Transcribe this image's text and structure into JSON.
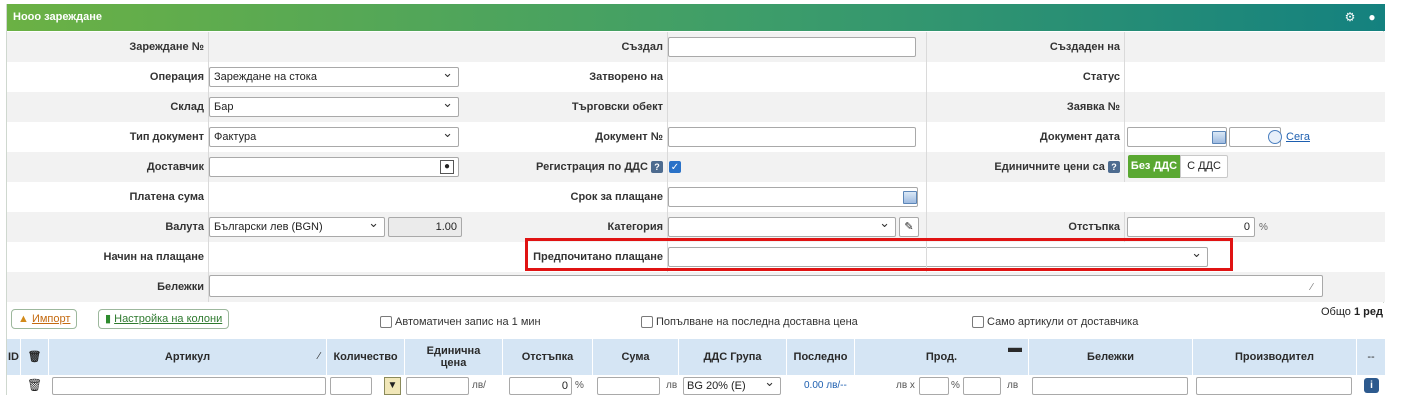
{
  "window": {
    "title": "Нооо зареждане"
  },
  "header_icons": [
    "gear-icon",
    "collapse-icon"
  ],
  "form": {
    "zarezhdane_no": {
      "label": "Зареждане №",
      "value": ""
    },
    "operation": {
      "label": "Операция",
      "value": "Зареждане на стока"
    },
    "sklad": {
      "label": "Склад",
      "value": "Бар"
    },
    "doc_type": {
      "label": "Тип документ",
      "value": "Фактура"
    },
    "dostavchik": {
      "label": "Доставчик",
      "value": ""
    },
    "platena_suma": {
      "label": "Платена сума",
      "value": ""
    },
    "valuta": {
      "label": "Валута",
      "value": "Български лев (BGN)",
      "rate": "1.00"
    },
    "nachin_plashtane": {
      "label": "Начин на плащане",
      "value": ""
    },
    "sazdal": {
      "label": "Създал",
      "value": ""
    },
    "zatvoreno_na": {
      "label": "Затворено на",
      "value": ""
    },
    "targovski_obekt": {
      "label": "Търговски обект",
      "value": ""
    },
    "dokument_no": {
      "label": "Документ №",
      "value": ""
    },
    "registracia_dds": {
      "label": "Регистрация по ДДС",
      "checked": true
    },
    "srok_plashtane": {
      "label": "Срок за плащане",
      "value": ""
    },
    "kategoria": {
      "label": "Категория",
      "value": ""
    },
    "predpochitano": {
      "label": "Предпочитано плащане",
      "value": ""
    },
    "sazdaden_na": {
      "label": "Създаден на",
      "value": ""
    },
    "status": {
      "label": "Статус",
      "value": ""
    },
    "zayavka_no": {
      "label": "Заявка №",
      "value": ""
    },
    "dokument_data": {
      "label": "Документ дата",
      "now_link": "Сега"
    },
    "edinichni_ceni": {
      "label": "Единичните цени са",
      "options": [
        "Без ДДС",
        "С ДДС"
      ],
      "selected": "Без ДДС"
    },
    "otstapka": {
      "label": "Отстъпка",
      "value": "0",
      "unit": "%"
    },
    "belejki": {
      "label": "Бележки",
      "value": ""
    }
  },
  "toolbar": {
    "import_label": "Импорт",
    "columns_label": "Настройка на колони",
    "auto_save_label": "Автоматичен запис на 1 мин",
    "last_price_label": "Попълване на последна доставна цена",
    "supplier_only_label": "Само артикули от доставчика",
    "total_label": "Общо",
    "total_count": "1 ред"
  },
  "table": {
    "columns": [
      "ID",
      "Артикул",
      "Количество",
      "Единична цена",
      "Отстъпка",
      "Сума",
      "ДДС Група",
      "Последно",
      "Прод.",
      "Бележки",
      "Производител",
      "--"
    ],
    "row": {
      "unit_price_suffix": "лв/",
      "discount": "0",
      "discount_unit": "%",
      "sum_unit": "лв",
      "vat_group": "BG 20% (E)",
      "last_price": "0.00 лв/--",
      "prod_prefix": "лв x",
      "prod_pct": "%",
      "prod_unit": "лв"
    }
  },
  "colors": {
    "header_start": "#6bb144",
    "header_end": "#14817f",
    "highlight": "#e01313",
    "accent_green": "#5aa832",
    "table_header": "#d5e5f4"
  }
}
